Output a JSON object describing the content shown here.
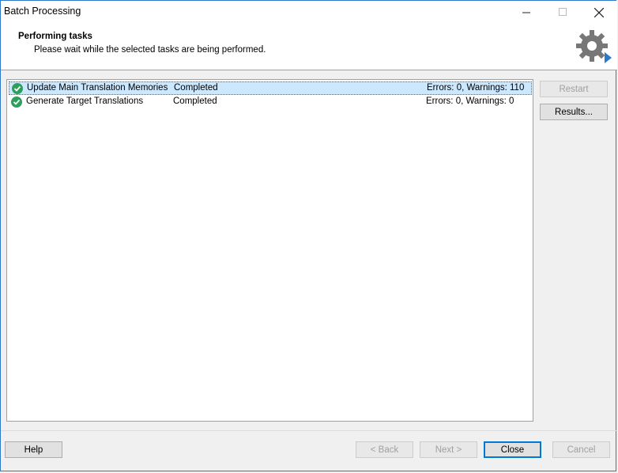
{
  "window": {
    "title": "Batch Processing"
  },
  "header": {
    "title": "Performing tasks",
    "subtitle": "Please wait while the selected tasks are being performed."
  },
  "tasks": [
    {
      "name": "Update Main Translation Memories",
      "status": "Completed",
      "result": "Errors: 0, Warnings: 110",
      "selected": true
    },
    {
      "name": "Generate Target Translations",
      "status": "Completed",
      "result": "Errors: 0, Warnings: 0",
      "selected": false
    }
  ],
  "side_buttons": {
    "restart": "Restart",
    "results": "Results..."
  },
  "footer": {
    "help": "Help",
    "back": "< Back",
    "next": "Next >",
    "close": "Close",
    "cancel": "Cancel"
  },
  "colors": {
    "accent": "#0078d7",
    "success": "#2e9e5b",
    "selection": "#cce8ff"
  }
}
